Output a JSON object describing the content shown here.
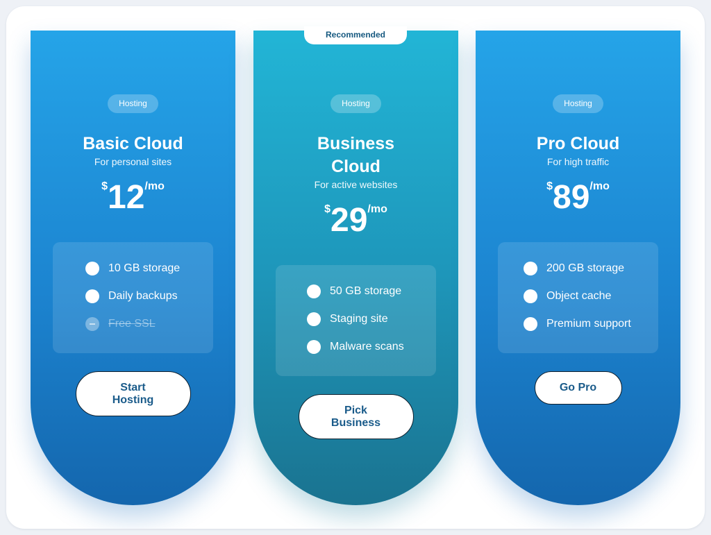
{
  "plans": [
    {
      "tag": "Hosting",
      "title": "Basic Cloud",
      "subtitle": "For personal sites",
      "currency": "$",
      "price": "12",
      "period": "/mo",
      "features": [
        {
          "label": "10 GB storage",
          "included": true
        },
        {
          "label": "Daily backups",
          "included": true
        },
        {
          "label": "Free SSL",
          "included": false
        }
      ],
      "cta": "Start Hosting"
    },
    {
      "badge": "Recommended",
      "tag": "Hosting",
      "title": "Business Cloud",
      "subtitle": "For active websites",
      "currency": "$",
      "price": "29",
      "period": "/mo",
      "features": [
        {
          "label": "50 GB storage",
          "included": true
        },
        {
          "label": "Staging site",
          "included": true
        },
        {
          "label": "Malware scans",
          "included": true
        }
      ],
      "cta": "Pick Business"
    },
    {
      "tag": "Hosting",
      "title": "Pro Cloud",
      "subtitle": "For high traffic",
      "currency": "$",
      "price": "89",
      "period": "/mo",
      "features": [
        {
          "label": "200 GB storage",
          "included": true
        },
        {
          "label": "Object cache",
          "included": true
        },
        {
          "label": "Premium support",
          "included": true
        }
      ],
      "cta": "Go Pro"
    }
  ],
  "colors": {
    "card_blue_top": "#25a4e8",
    "card_blue_bottom": "#1466ad",
    "card_teal_top": "#22b5d6",
    "card_teal_bottom": "#1a7390",
    "button_text": "#1a5b8a",
    "badge_text": "#15587f"
  },
  "icons": {
    "feature_included": "filled-circle-icon",
    "feature_excluded": "minus-circle-icon"
  }
}
